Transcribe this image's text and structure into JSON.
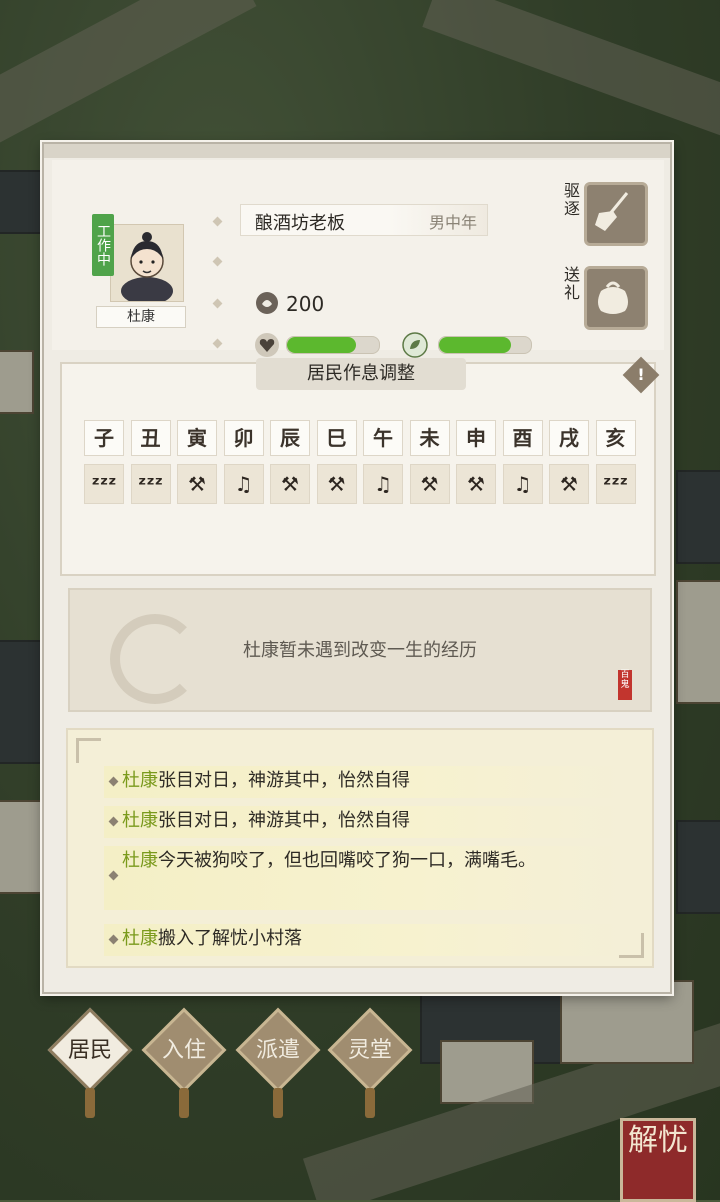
{
  "resident": {
    "status_tag": "工作中",
    "name": "杜康",
    "job_title": "酿酒坊老板",
    "gender_age": "男中年",
    "coins": "200",
    "health_level": 0.75,
    "mood_level": 0.78
  },
  "actions": {
    "expel_label": "驱逐",
    "gift_label": "送礼"
  },
  "schedule": {
    "title": "居民作息调整",
    "hours": [
      "子",
      "丑",
      "寅",
      "卯",
      "辰",
      "巳",
      "午",
      "未",
      "申",
      "酉",
      "戌",
      "亥"
    ],
    "activities": [
      "sleep-icon",
      "sleep-icon",
      "hammer-icon",
      "entertainment-icon",
      "hammer-icon",
      "hammer-icon",
      "entertainment-icon",
      "hammer-icon",
      "hammer-icon",
      "entertainment-icon",
      "hammer-icon",
      "sleep-icon"
    ]
  },
  "experience": {
    "text": "杜康暂未遇到改变一生的经历",
    "seal_text": "百鬼"
  },
  "log": [
    {
      "name": "杜康",
      "text": "张目对日，神游其中，怡然自得"
    },
    {
      "name": "杜康",
      "text": "张目对日，神游其中，怡然自得"
    },
    {
      "name": "杜康",
      "text": "今天被狗咬了，但也回嘴咬了狗一口，满嘴毛。"
    },
    {
      "name": "杜康",
      "text": "搬入了解忧小村落"
    }
  ],
  "nav": {
    "residents": "居民",
    "move_in": "入住",
    "dispatch": "派遣",
    "memorial": "灵堂"
  },
  "corner_seal": "解忧",
  "colors": {
    "bar_fill": "#5cb82e",
    "name_highlight": "#7a9a1c",
    "status_tag": "#4fa34a"
  }
}
